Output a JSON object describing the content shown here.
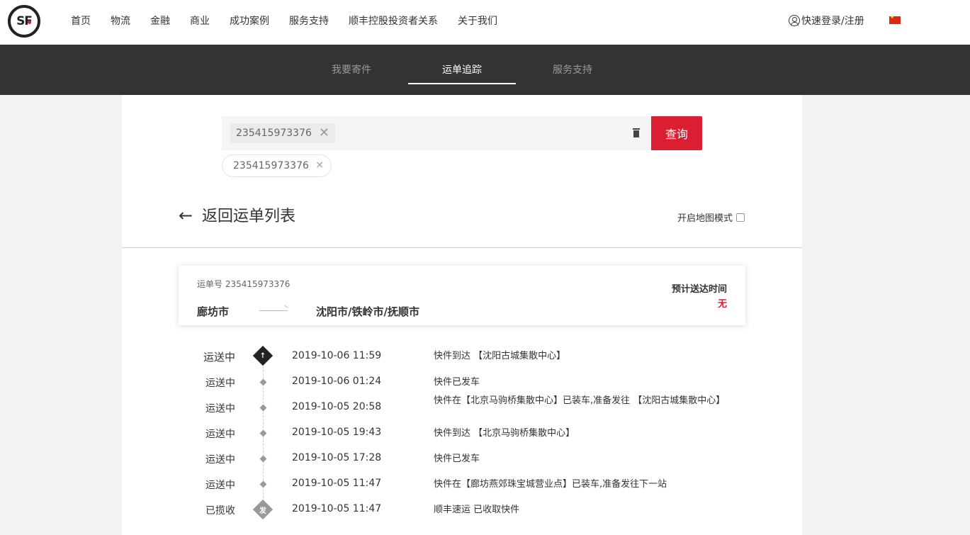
{
  "logo": {
    "text": "SF"
  },
  "nav": {
    "items": [
      "首页",
      "物流",
      "金融",
      "商业",
      "成功案例",
      "服务支持",
      "顺丰控股投资者关系",
      "关于我们"
    ]
  },
  "header": {
    "login_label": "快速登录/注册"
  },
  "subnav": {
    "tabs": [
      {
        "label": "我要寄件"
      },
      {
        "label": "运单追踪"
      },
      {
        "label": "服务支持"
      }
    ]
  },
  "search": {
    "chip_value": "235415973376",
    "button_label": "查询"
  },
  "history": {
    "chip_value": "235415973376",
    "close": "×"
  },
  "back": {
    "arrow": "←",
    "label": "返回运单列表"
  },
  "map_mode": {
    "label": "开启地图模式"
  },
  "waybill": {
    "number_label": "运单号 235415973376",
    "from": "廊坊市",
    "to": "沈阳市/铁岭市/抚顺市",
    "eta_label": "预计送达时间",
    "eta_value": "无"
  },
  "timeline": [
    {
      "status": "运送中",
      "time": "2019-10-06 11:59",
      "desc": "快件到达 【沈阳古城集散中心】",
      "marker": "↑"
    },
    {
      "status": "运送中",
      "time": "2019-10-06 01:24",
      "desc": "快件已发车"
    },
    {
      "status": "运送中",
      "time": "2019-10-05 20:58",
      "desc": "快件在【北京马驹桥集散中心】已装车,准备发往 【沈阳古城集散中心】"
    },
    {
      "status": "运送中",
      "time": "2019-10-05 19:43",
      "desc": "快件到达 【北京马驹桥集散中心】"
    },
    {
      "status": "运送中",
      "time": "2019-10-05 17:28",
      "desc": "快件已发车"
    },
    {
      "status": "运送中",
      "time": "2019-10-05 11:47",
      "desc": "快件在【廊坊燕郊珠宝城营业点】已装车,准备发往下一站"
    },
    {
      "status": "已揽收",
      "time": "2019-10-05 11:47",
      "desc": "顺丰速运 已收取快件",
      "marker": "发"
    }
  ],
  "colors": {
    "brand_red": "#dc1e32",
    "subnav_bg": "#333333"
  }
}
